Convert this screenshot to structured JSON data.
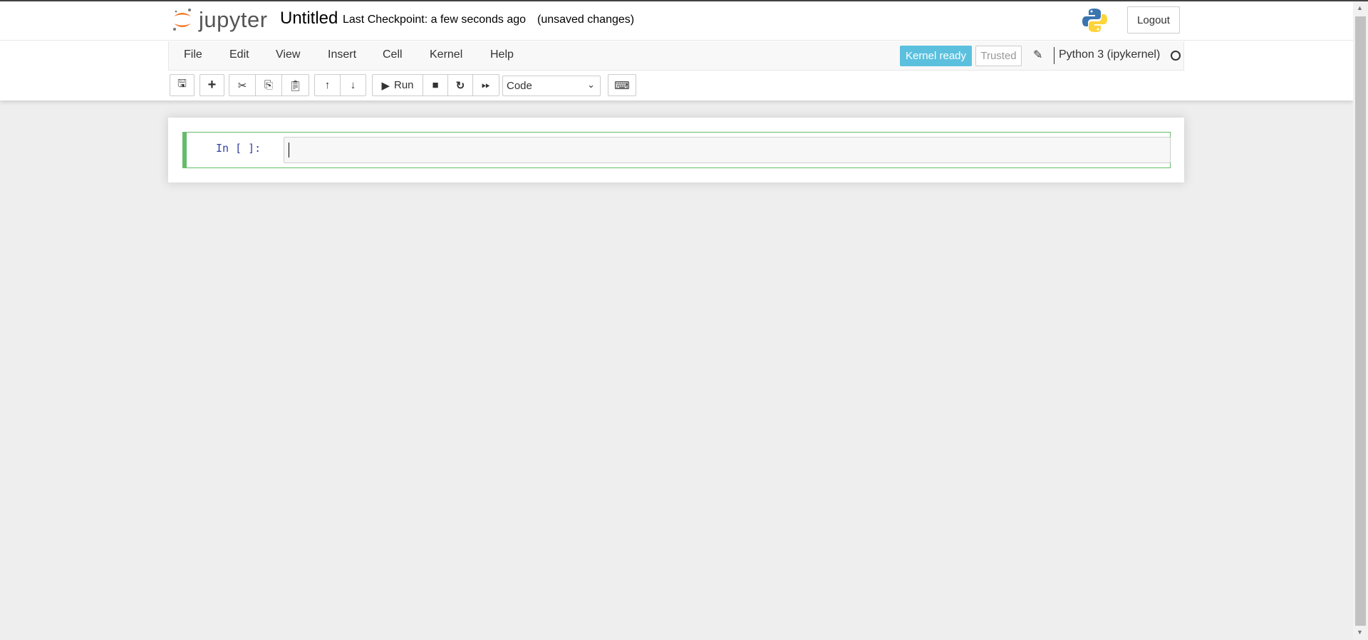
{
  "header": {
    "logo_text": "jupyter",
    "notebook_name": "Untitled",
    "checkpoint": "Last Checkpoint: a few seconds ago",
    "unsaved": "(unsaved changes)",
    "logout": "Logout"
  },
  "menu": [
    "File",
    "Edit",
    "View",
    "Insert",
    "Cell",
    "Kernel",
    "Help"
  ],
  "kernel": {
    "status": "Kernel ready",
    "trusted": "Trusted",
    "name": "Python 3 (ipykernel)",
    "status_color": "#5bc0de"
  },
  "toolbar": {
    "run_label": "Run",
    "cell_type": "Code"
  },
  "cell": {
    "prompt": "In [ ]:",
    "content": ""
  }
}
